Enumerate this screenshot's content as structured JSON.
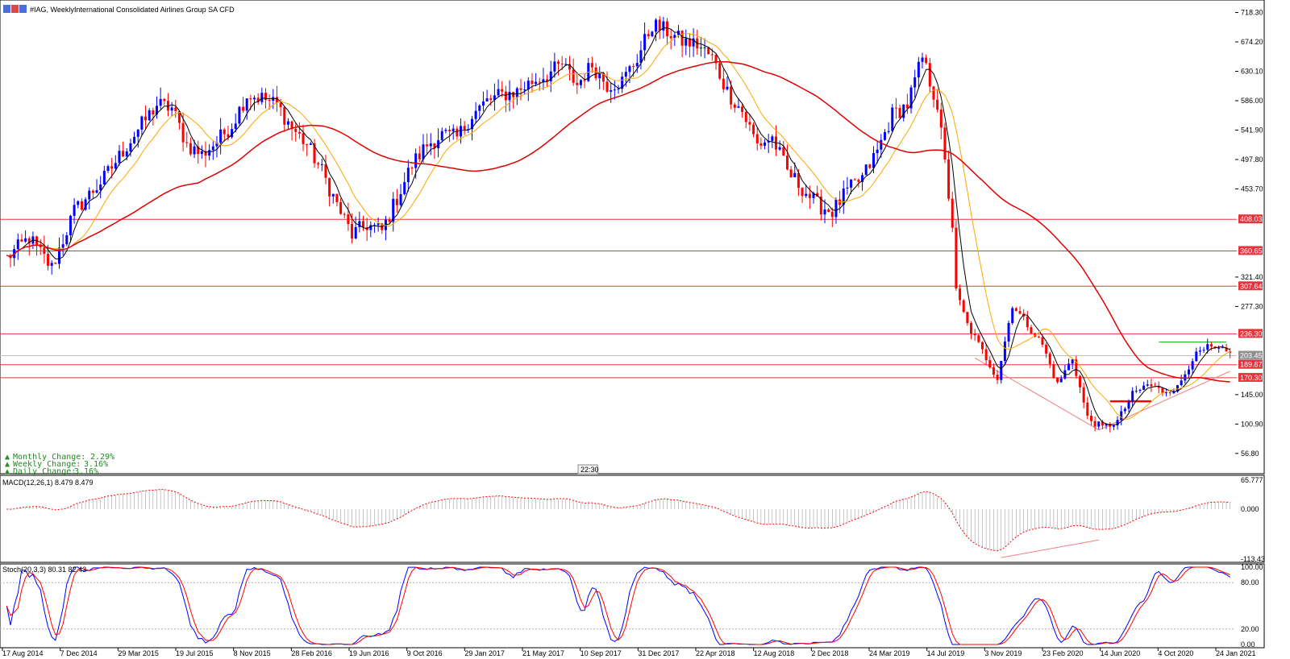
{
  "header": {
    "symbol_text": "#IAG, Weekly:",
    "description": "International Consolidated Airlines Group SA CFD"
  },
  "changes": [
    {
      "label": "Monthly Change:",
      "value": "2.29%"
    },
    {
      "label": "Weekly Change:",
      "value": "3.16%"
    },
    {
      "label": "Daily Change:",
      "value": "3.16%"
    }
  ],
  "time_badge": "22:30",
  "colors": {
    "bull": "#0000ff",
    "bear": "#ff0000",
    "ma_fast": "#000000",
    "ma_mid": "#ffa500",
    "ma_slow": "#e00000",
    "level": "#e8333c",
    "change_green": "#1e8c1e",
    "grid": "#c0c0c0"
  },
  "chart_data": [
    {
      "type": "candlestick",
      "symbol": "#IAG",
      "timeframe": "Weekly",
      "y_ticks": [
        "718.30",
        "674.20",
        "630.10",
        "586.00",
        "541.90",
        "497.80",
        "453.70",
        "408.03",
        "360.65",
        "321.40",
        "307.64",
        "277.30",
        "236.30",
        "203.45",
        "189.87",
        "170.30",
        "145.00",
        "100.90",
        "56.80"
      ],
      "x_ticks": [
        "17 Aug 2014",
        "7 Dec 2014",
        "29 Mar 2015",
        "19 Jul 2015",
        "8 Nov 2015",
        "28 Feb 2016",
        "19 Jun 2016",
        "9 Oct 2016",
        "29 Jan 2017",
        "21 May 2017",
        "10 Sep 2017",
        "31 Dec 2017",
        "22 Apr 2018",
        "12 Aug 2018",
        "2 Dec 2018",
        "24 Mar 2019",
        "14 Jul 2019",
        "3 Nov 2019",
        "23 Feb 2020",
        "14 Jun 2020",
        "4 Oct 2020",
        "24 Jan 2021"
      ],
      "ylim": [
        30,
        725
      ],
      "horizontal_levels": [
        408.03,
        360.65,
        307.64,
        236.3,
        189.87,
        170.3
      ],
      "current_price": 203.45,
      "price_badges": [
        "408.03",
        "360.65",
        "307.64",
        "236.30",
        "203.45",
        "189.87",
        "170.30"
      ],
      "close_path": [
        [
          0,
          350
        ],
        [
          6,
          380
        ],
        [
          12,
          335
        ],
        [
          18,
          420
        ],
        [
          26,
          470
        ],
        [
          34,
          535
        ],
        [
          40,
          580
        ],
        [
          44,
          575
        ],
        [
          48,
          520
        ],
        [
          52,
          505
        ],
        [
          56,
          525
        ],
        [
          60,
          550
        ],
        [
          64,
          595
        ],
        [
          68,
          590
        ],
        [
          72,
          580
        ],
        [
          76,
          545
        ],
        [
          80,
          520
        ],
        [
          84,
          480
        ],
        [
          88,
          430
        ],
        [
          92,
          385
        ],
        [
          96,
          400
        ],
        [
          100,
          390
        ],
        [
          104,
          440
        ],
        [
          108,
          490
        ],
        [
          112,
          520
        ],
        [
          116,
          535
        ],
        [
          120,
          530
        ],
        [
          124,
          565
        ],
        [
          128,
          585
        ],
        [
          132,
          595
        ],
        [
          136,
          600
        ],
        [
          140,
          615
        ],
        [
          144,
          625
        ],
        [
          148,
          640
        ],
        [
          152,
          610
        ],
        [
          156,
          640
        ],
        [
          160,
          610
        ],
        [
          164,
          615
        ],
        [
          168,
          650
        ],
        [
          172,
          700
        ],
        [
          176,
          690
        ],
        [
          180,
          675
        ],
        [
          184,
          670
        ],
        [
          188,
          650
        ],
        [
          192,
          600
        ],
        [
          196,
          570
        ],
        [
          200,
          520
        ],
        [
          204,
          530
        ],
        [
          208,
          480
        ],
        [
          212,
          455
        ],
        [
          216,
          430
        ],
        [
          220,
          420
        ],
        [
          224,
          450
        ],
        [
          228,
          470
        ],
        [
          232,
          510
        ],
        [
          236,
          565
        ],
        [
          240,
          580
        ],
        [
          244,
          650
        ],
        [
          248,
          580
        ],
        [
          252,
          400
        ],
        [
          253,
          300
        ],
        [
          256,
          250
        ],
        [
          260,
          210
        ],
        [
          264,
          170
        ],
        [
          268,
          280
        ],
        [
          272,
          250
        ],
        [
          276,
          220
        ],
        [
          280,
          160
        ],
        [
          284,
          200
        ],
        [
          288,
          110
        ],
        [
          292,
          95
        ],
        [
          296,
          105
        ],
        [
          300,
          145
        ],
        [
          304,
          160
        ],
        [
          308,
          150
        ],
        [
          312,
          155
        ],
        [
          316,
          200
        ],
        [
          320,
          215
        ],
        [
          324,
          210
        ],
        [
          326,
          206
        ]
      ],
      "macd": {
        "label": "MACD(12,26,1) 8.479 8.479",
        "y_ticks": [
          "65.777",
          "0.000",
          "-113.43"
        ],
        "ylim": [
          -113.43,
          65.777
        ]
      },
      "stochastic": {
        "label": "Stoch(20,3,3) 80.31 82.43",
        "y_ticks": [
          "100.00",
          "80.00",
          "20.00",
          "0.00"
        ],
        "ylim": [
          0,
          100
        ]
      }
    }
  ]
}
